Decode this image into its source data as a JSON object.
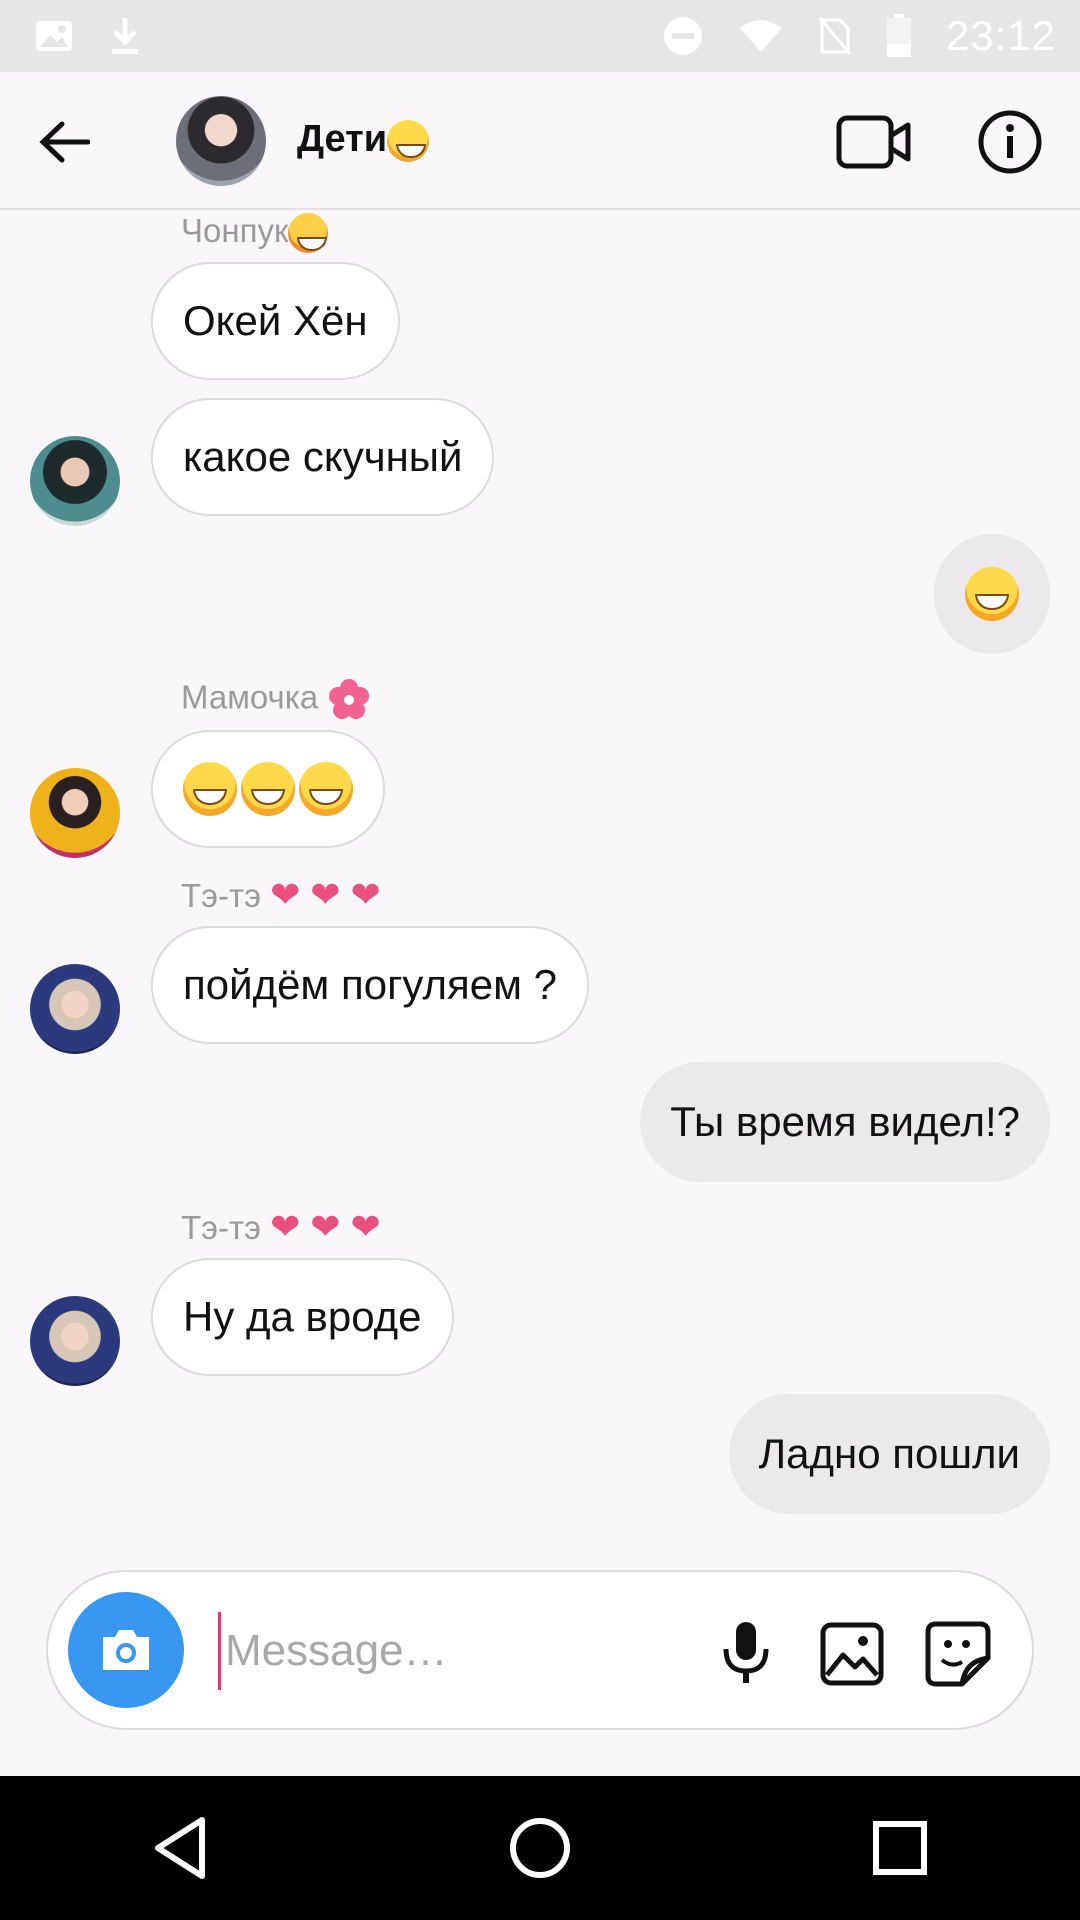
{
  "status_bar": {
    "time": "23:12"
  },
  "header": {
    "title": "Дети",
    "title_emoji": "grinning-sweat-emoji"
  },
  "messages": [
    {
      "type": "incoming",
      "sender": "Чонпук",
      "text": "Окей Хён"
    },
    {
      "type": "incoming",
      "text": "какое скучный"
    },
    {
      "type": "outgoing",
      "emoji": "grinning-sweat-emoji"
    },
    {
      "type": "incoming",
      "sender": "Мамочка",
      "emoji": "grinning-sweat-emoji-x3"
    },
    {
      "type": "incoming",
      "sender": "Тэ-тэ",
      "text": "пойдём погуляем ?"
    },
    {
      "type": "outgoing",
      "text": "Ты время видел!?"
    },
    {
      "type": "incoming",
      "sender": "Тэ-тэ",
      "text": "Ну да вроде"
    },
    {
      "type": "outgoing",
      "text": "Ладно пошли"
    }
  ],
  "composer": {
    "placeholder": "Message…"
  },
  "colors": {
    "accent_blue": "#3897f0",
    "heart_pink": "#e8507e",
    "blossom_pink": "#f06292",
    "cursor_pink": "#e2386c"
  },
  "icons": [
    "back-arrow-icon",
    "video-call-icon",
    "info-icon",
    "camera-icon",
    "microphone-icon",
    "gallery-icon",
    "sticker-icon",
    "nav-back-icon",
    "nav-home-icon",
    "nav-recents-icon"
  ]
}
